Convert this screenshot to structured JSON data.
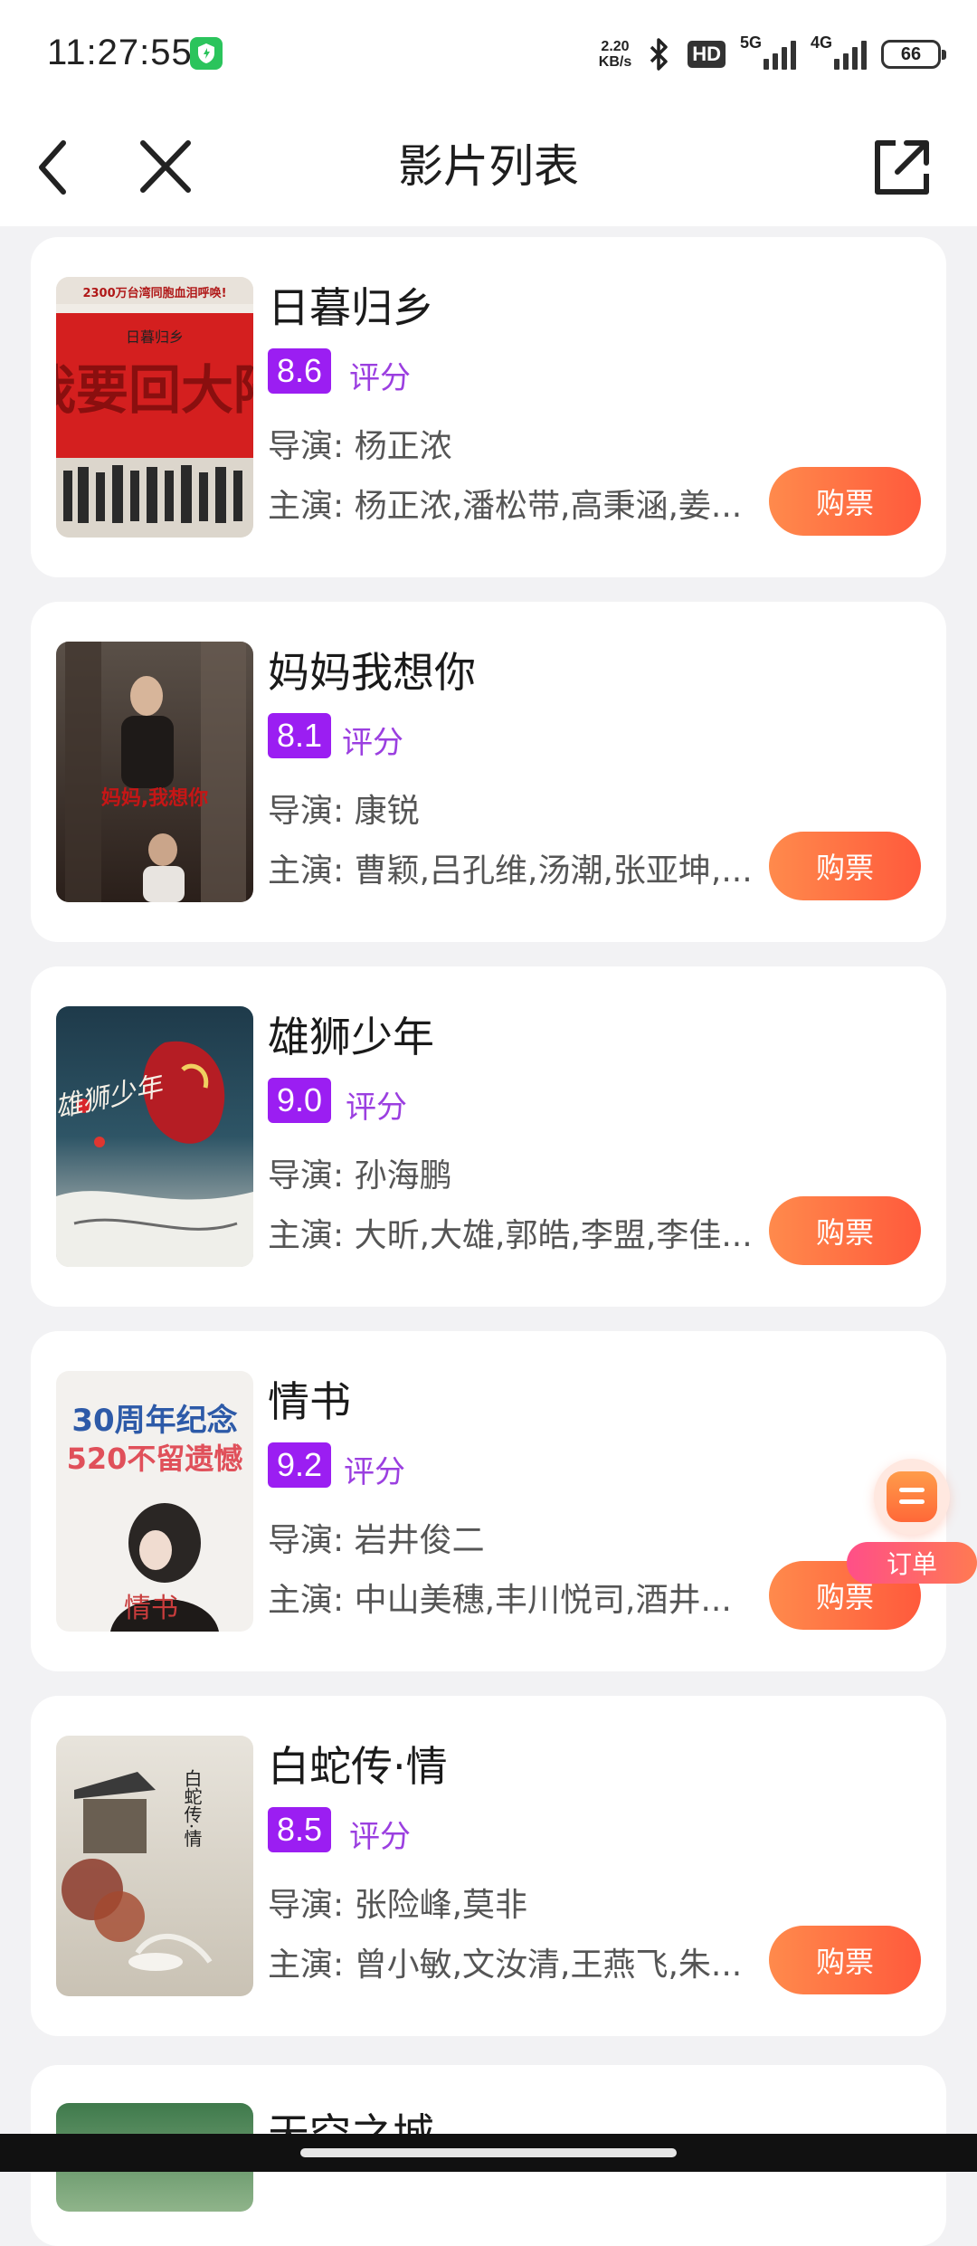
{
  "status_bar": {
    "time": "11:27:55",
    "net_speed_value": "2.20",
    "net_speed_unit": "KB/s",
    "hd_label": "HD",
    "signal_5g": "5G",
    "signal_4g": "4G",
    "battery": "66",
    "icons": [
      "shield-icon",
      "bluetooth-icon",
      "signal-icon",
      "battery-icon"
    ]
  },
  "nav": {
    "title": "影片列表",
    "icons": [
      "back-icon",
      "close-icon",
      "share-icon"
    ]
  },
  "score_label": "评分",
  "buy_label": "购票",
  "movies": [
    {
      "title": "日暮归乡",
      "score": "8.6",
      "director": "导演: 杨正浓",
      "cast": "主演: 杨正浓,潘松带,高秉涵,姜...",
      "poster_text": "2300万台湾同胞血泪呼唤!",
      "poster_big": "我要回大陆",
      "poster_sub": "日暮归乡"
    },
    {
      "title": "妈妈我想你",
      "score": "8.1",
      "director": "导演: 康锐",
      "cast": "主演: 曹颖,吕孔维,汤潮,张亚坤,...",
      "poster_text": "妈妈,我想你"
    },
    {
      "title": "雄狮少年",
      "score": "9.0",
      "director": "导演: 孙海鹏",
      "cast": "主演: 大昕,大雄,郭皓,李盟,李佳...",
      "poster_text": "雄狮少年"
    },
    {
      "title": "情书",
      "score": "9.2",
      "director": "导演: 岩井俊二",
      "cast": "主演: 中山美穗,丰川悦司,酒井...",
      "poster_line1": "30周年纪念",
      "poster_line2": "520不留遗憾",
      "poster_text": "情书"
    },
    {
      "title": "白蛇传·情",
      "score": "8.5",
      "director": "导演: 张险峰,莫非",
      "cast": "主演: 曾小敏,文汝清,王燕飞,朱...",
      "poster_text": "白蛇传·情"
    }
  ],
  "partial_movie": {
    "title": "天空之城"
  },
  "float_order": {
    "label": "订单",
    "icon": "order-icon"
  },
  "colors": {
    "score_badge": "#9b1ef2",
    "buy_button_start": "#ff8a4c",
    "buy_button_end": "#ff5a3c",
    "background": "#f2f2f4"
  }
}
